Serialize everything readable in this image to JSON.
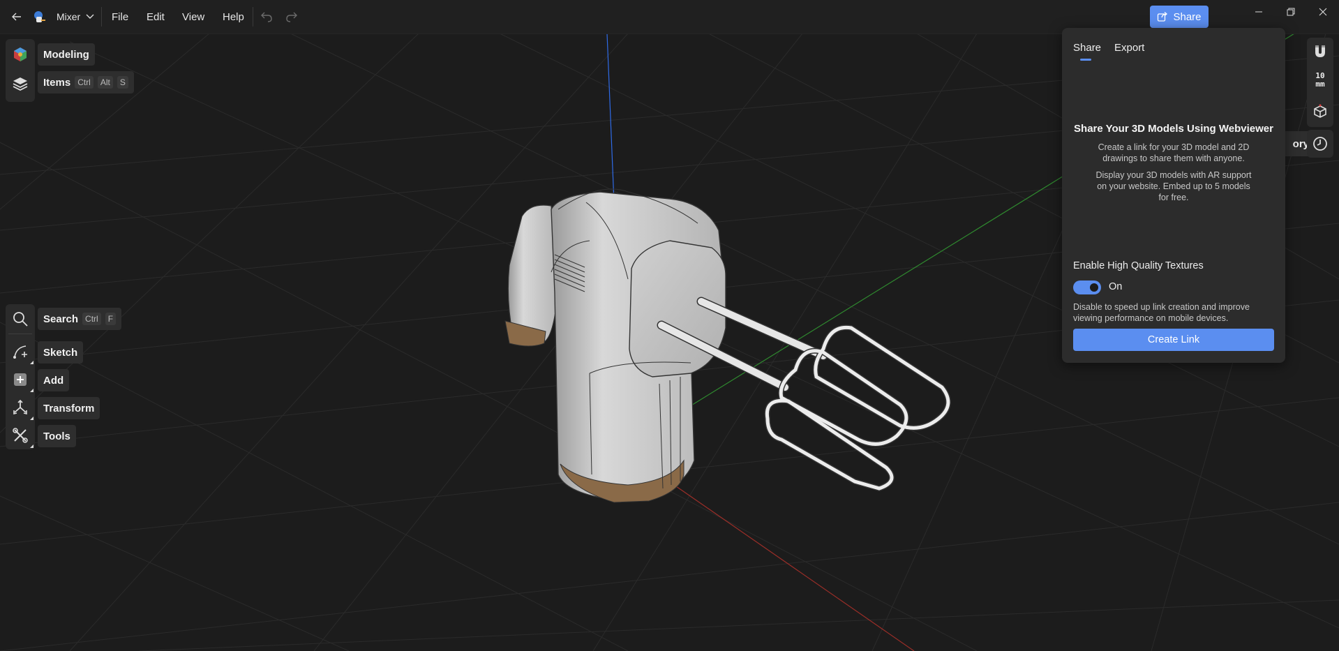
{
  "titlebar": {
    "app_icon": "mixer-app-icon",
    "document_name": "Mixer",
    "menu": [
      "File",
      "Edit",
      "View",
      "Help"
    ],
    "share_label": "Share"
  },
  "left_toolbar": {
    "workspace_label": "Modeling",
    "items_label": "Items",
    "items_shortcut": [
      "Ctrl",
      "Alt",
      "S"
    ],
    "search_label": "Search",
    "search_shortcut": [
      "Ctrl",
      "F"
    ],
    "sketch_label": "Sketch",
    "add_label": "Add",
    "transform_label": "Transform",
    "tools_label": "Tools"
  },
  "share_panel": {
    "tabs": [
      "Share",
      "Export"
    ],
    "active_tab": "Share",
    "heading": "Share Your 3D Models Using Webviewer",
    "para1": "Create a link for your 3D model and 2D drawings to share them with anyone.",
    "para2": "Display your 3D models with AR support on your website. Embed up to 5 models for free.",
    "hq_label": "Enable High Quality Textures",
    "toggle_state": "On",
    "hq_description": "Disable to speed up link creation and improve viewing performance on mobile devices.",
    "create_button": "Create Link"
  },
  "right_toolbar": {
    "units_value": "10",
    "units_unit": "mm",
    "history_partial": "ory"
  },
  "colors": {
    "accent": "#5b8ef0",
    "background": "#1b1b1b",
    "panel": "#2c2c2c"
  }
}
